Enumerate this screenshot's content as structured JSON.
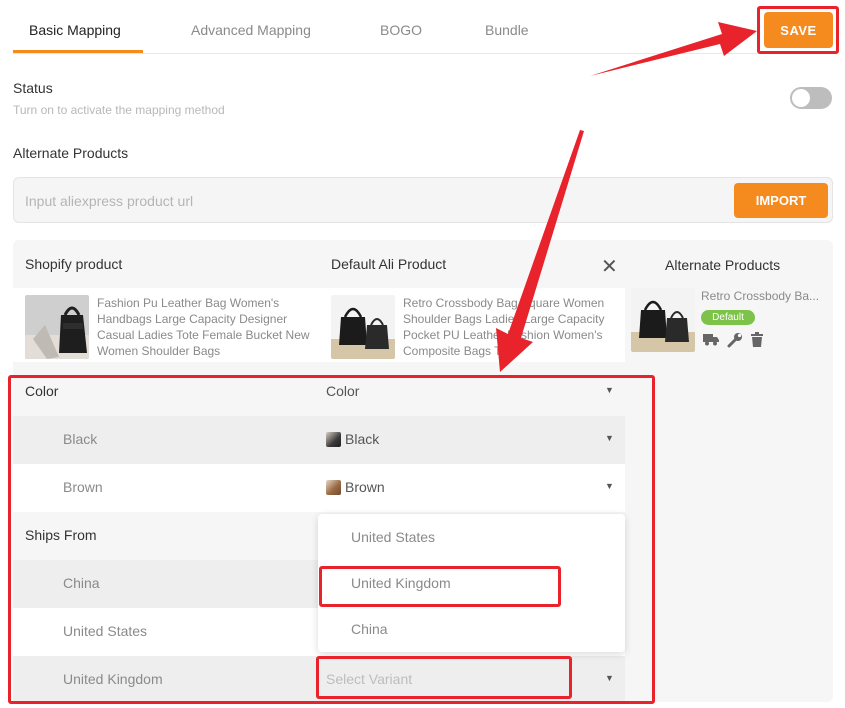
{
  "tabs": [
    {
      "label": "Basic Mapping",
      "active": true
    },
    {
      "label": "Advanced Mapping",
      "active": false
    },
    {
      "label": "BOGO",
      "active": false
    },
    {
      "label": "Bundle",
      "active": false
    }
  ],
  "save_label": "SAVE",
  "status": {
    "title": "Status",
    "subtitle": "Turn on to activate the mapping method",
    "enabled": false
  },
  "alternate": {
    "title": "Alternate Products",
    "url_placeholder": "Input aliexpress product url",
    "url_value": "",
    "import_label": "IMPORT"
  },
  "mapping": {
    "shopify_header": "Shopify product",
    "ali_header": "Default Ali Product",
    "alternate_header": "Alternate Products",
    "shopify_product": "Fashion Pu Leather Bag Women's Handbags Large Capacity Designer Casual Ladies Tote Female Bucket New Women Shoulder Bags",
    "ali_product": "Retro Crossbody Bag Square Women Shoulder Bags Ladies Large Capacity Pocket PU Leather Fashion Women's Composite Bags Tote",
    "alternate_product_name": "Retro Crossbody Ba...",
    "default_badge": "Default",
    "icons": [
      "truck-icon",
      "wrench-icon",
      "trash-icon"
    ],
    "rows": [
      {
        "left": "Color",
        "right": "Color"
      },
      {
        "left": "Black",
        "right": "Black"
      },
      {
        "left": "Brown",
        "right": "Brown"
      },
      {
        "left": "Ships From",
        "right": ""
      },
      {
        "left": "China",
        "right": ""
      },
      {
        "left": "United States",
        "right": ""
      },
      {
        "left": "United Kingdom",
        "right_placeholder": "Select Variant"
      }
    ]
  },
  "dropdown_options": [
    "United States",
    "United Kingdom",
    "China"
  ],
  "colors": {
    "accent": "#f58a1f",
    "annotation_red": "#e8232b",
    "badge_green": "#7dc349"
  }
}
